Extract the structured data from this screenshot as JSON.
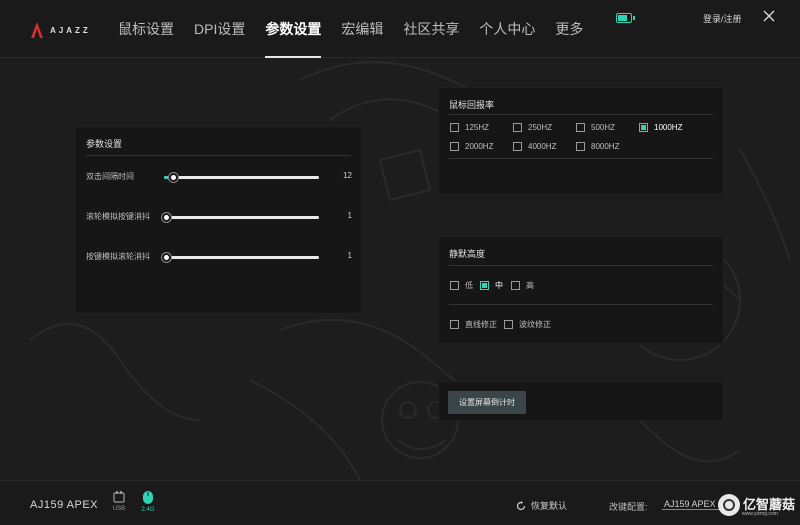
{
  "header": {
    "logo_text": "AJAZZ",
    "tabs": [
      {
        "label": "鼠标设置",
        "active": false
      },
      {
        "label": "DPI设置",
        "active": false
      },
      {
        "label": "参数设置",
        "active": true
      },
      {
        "label": "宏编辑",
        "active": false
      },
      {
        "label": "社区共享",
        "active": false
      },
      {
        "label": "个人中心",
        "active": false
      },
      {
        "label": "更多",
        "active": false
      }
    ],
    "battery_level": 0.7,
    "login_label": "登录/注册"
  },
  "params": {
    "title": "参数设置",
    "sliders": [
      {
        "label": "双击间隔时间",
        "value": "12",
        "fraction": 0.06
      },
      {
        "label": "滚轮模拟按键消抖",
        "value": "1",
        "fraction": 0.0
      },
      {
        "label": "按键模拟滚轮消抖",
        "value": "1",
        "fraction": 0.0
      }
    ]
  },
  "polling": {
    "title": "鼠标回报率",
    "options": [
      {
        "label": "125HZ",
        "checked": false
      },
      {
        "label": "250HZ",
        "checked": false
      },
      {
        "label": "500HZ",
        "checked": false
      },
      {
        "label": "1000HZ",
        "checked": true
      },
      {
        "label": "2000HZ",
        "checked": false
      },
      {
        "label": "4000HZ",
        "checked": false
      },
      {
        "label": "8000HZ",
        "checked": false
      }
    ]
  },
  "silent": {
    "title": "静默高度",
    "levels": [
      {
        "label": "低",
        "checked": false
      },
      {
        "label": "中",
        "checked": true
      },
      {
        "label": "高",
        "checked": false
      }
    ],
    "corrections": [
      {
        "label": "直线修正",
        "checked": false
      },
      {
        "label": "波纹修正",
        "checked": false
      }
    ]
  },
  "countdown": {
    "button_label": "设置屏幕倒计时"
  },
  "footer": {
    "model": "AJ159 APEX",
    "usb_label": "USB",
    "wireless_label": "2.4G",
    "restore_label": "恢复默认",
    "keymap_label": "改键配置:",
    "keymap_value": "AJ159 APEX",
    "watermark": "亿智蘑菇",
    "watermark_sub": "www.yizmg.com"
  },
  "colors": {
    "accent": "#2fd3b5",
    "background": "#1d1d1d",
    "panel": "#161616"
  }
}
